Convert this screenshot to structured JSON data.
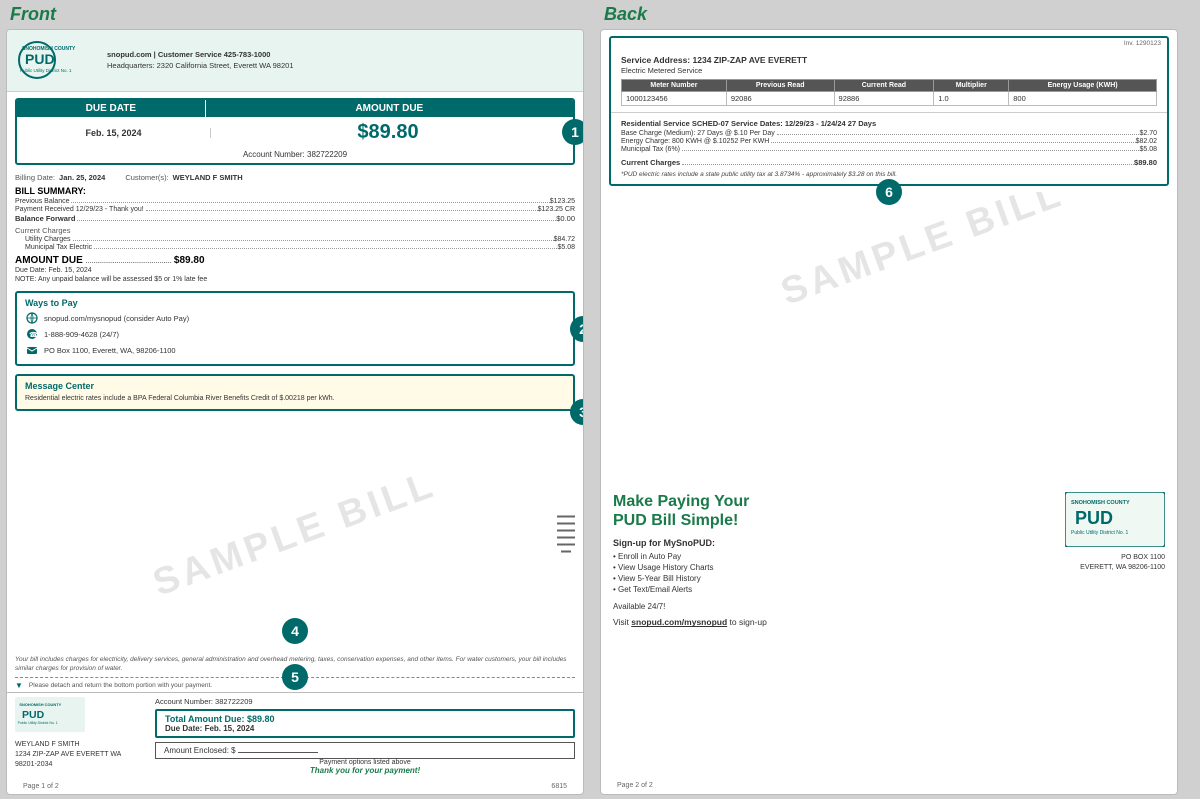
{
  "front_label": "Front",
  "back_label": "Back",
  "pud": {
    "website": "snopud.com",
    "customer_service": "Customer Service 425-783-1000",
    "headquarters": "Headquarters: 2320 California Street, Everett WA 98201",
    "name": "SNOHOMISH COUNTY",
    "subtitle": "PUD",
    "tagline": "Public Utility District No. 1"
  },
  "due_date": {
    "label": "DUE DATE",
    "value": "Feb. 15, 2024"
  },
  "amount_due": {
    "label": "AMOUNT DUE",
    "value": "$89.80"
  },
  "account_number": {
    "label": "Account Number:",
    "value": "382722209"
  },
  "badges": {
    "one": "1",
    "two": "2",
    "three": "3",
    "four": "4",
    "five": "5",
    "six": "6"
  },
  "billing_info": {
    "billing_date_label": "Billing Date:",
    "billing_date_value": "Jan. 25, 2024",
    "customers_label": "Customer(s):",
    "customers_value": "WEYLAND F SMITH"
  },
  "bill_summary": {
    "title": "BILL SUMMARY:",
    "previous_balance_label": "Previous Balance",
    "previous_balance_value": "$123.25",
    "payment_label": "Payment Received 12/29/23 - Thank you!",
    "payment_value": "$123.25 CR",
    "balance_forward_label": "Balance Forward",
    "balance_forward_value": "$0.00",
    "current_charges_title": "Current Charges",
    "utility_charges_label": "Utility Charges",
    "utility_charges_value": "$84.72",
    "municipal_tax_label": "Municipal Tax Electric",
    "municipal_tax_value": "$5.08",
    "amount_due_label": "AMOUNT DUE",
    "amount_due_dots": "............................................",
    "amount_due_value": "$89.80",
    "due_date_note": "Due Date: Feb. 15, 2024",
    "note": "NOTE:  Any unpaid balance will be assessed $5 or 1% late fee"
  },
  "ways_to_pay": {
    "title": "Ways to Pay",
    "option1": "snopud.com/mysnopud (consider Auto Pay)",
    "option2": "1-888-909-4628 (24/7)",
    "option3": "PO Box 1100, Everett, WA, 98206-1100"
  },
  "message_center": {
    "title": "Message Center",
    "text": "Residential electric rates include a BPA Federal Columbia River Benefits Credit of $.00218 per kWh."
  },
  "detach_note": "Please detach and return the bottom portion with your payment.",
  "footer_italic": "Your bill includes charges for electricity, delivery services, general administration and overhead metering, taxes, conservation expenses, and other items. For water customers, your bill includes similar charges for provision of water.",
  "footer": {
    "account_number": "Account Number: 382722209",
    "total_due": "Total Amount Due: $89.80",
    "due_date": "Due Date: Feb. 15, 2024",
    "amount_enclosed": "Amount Enclosed: $",
    "payment_options": "Payment options listed above",
    "thank_you": "Thank you for your payment!",
    "address_name": "WEYLAND F SMITH",
    "address_line1": "1234 ZIP-ZAP AVE EVERETT WA",
    "address_line2": "98201-2034"
  },
  "page_numbers": {
    "front": "Page 1 of 2",
    "back": "Page 2 of 2",
    "barcode": "6815"
  },
  "back": {
    "inv_number": "Inv. 1290123",
    "service_address_label": "Service Address:",
    "service_address_value": "1234 ZIP-ZAP AVE",
    "city": "EVERETT",
    "electric_service": "Electric Metered Service",
    "table": {
      "headers": [
        "Meter Number",
        "Previous Read",
        "Current Read",
        "Multiplier",
        "Energy Usage (KWH)"
      ],
      "row": [
        "1000123456",
        "92086",
        "92886",
        "1.0",
        "800"
      ]
    },
    "residential_service": "Residential Service   SCHED-07   Service Dates: 12/29/23 - 1/24/24   27 Days",
    "charges": [
      {
        "label": "Base Charge (Medium): 27 Days @ $.10 Per Day",
        "value": "$2.70"
      },
      {
        "label": "Energy Charge: 800 KWH @ $.10252 Per KWH",
        "value": "$82.02"
      },
      {
        "label": "Municipal Tax (6%)",
        "value": "$5.08"
      }
    ],
    "current_charges_label": "Current Charges",
    "current_charges_value": "$89.80",
    "pud_note": "*PUD electric rates include a state public utility tax at 3.8734% - approximately $3.28 on this bill."
  },
  "make_paying": {
    "title_line1": "Make Paying Your",
    "title_line2": "PUD Bill Simple!",
    "signup_title": "Sign-up for MySnoPUD:",
    "items": [
      "• Enroll in Auto Pay",
      "• View Usage History Charts",
      "• View 5-Year Bill History",
      "• Get Text/Email Alerts"
    ],
    "available": "Available 24/7!",
    "visit_prefix": "Visit ",
    "visit_link": "snopud.com/mysnopud",
    "visit_suffix": " to sign-up"
  },
  "po_box": {
    "line1": "PO BOX 1100",
    "line2": "EVERETT, WA 98206-1100"
  }
}
